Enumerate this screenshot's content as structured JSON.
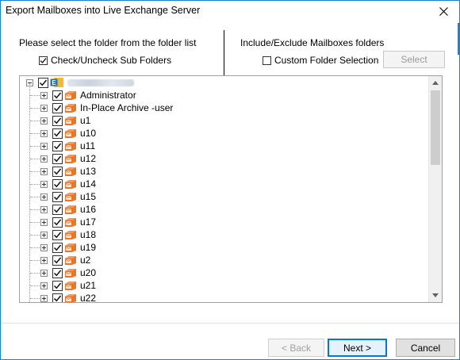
{
  "window": {
    "title": "Export Mailboxes into Live Exchange Server"
  },
  "left_panel": {
    "header": "Please select the folder from the folder list",
    "subfolders_checkbox": {
      "label": "Check/Uncheck Sub Folders",
      "checked": true
    }
  },
  "right_panel": {
    "header": "Include/Exclude Mailboxes folders",
    "custom_checkbox": {
      "label": "Custom Folder Selection",
      "checked": false
    },
    "select_button": "Select"
  },
  "tree": {
    "root": {
      "label_hidden": true,
      "expanded": true,
      "checked": true
    },
    "items": [
      {
        "label": "Administrator",
        "checked": true
      },
      {
        "label": "In-Place Archive -user",
        "checked": true
      },
      {
        "label": "u1",
        "checked": true
      },
      {
        "label": "u10",
        "checked": true
      },
      {
        "label": "u11",
        "checked": true
      },
      {
        "label": "u12",
        "checked": true
      },
      {
        "label": "u13",
        "checked": true
      },
      {
        "label": "u14",
        "checked": true
      },
      {
        "label": "u15",
        "checked": true
      },
      {
        "label": "u16",
        "checked": true
      },
      {
        "label": "u17",
        "checked": true
      },
      {
        "label": "u18",
        "checked": true
      },
      {
        "label": "u19",
        "checked": true
      },
      {
        "label": "u2",
        "checked": true
      },
      {
        "label": "u20",
        "checked": true
      },
      {
        "label": "u21",
        "checked": true
      },
      {
        "label": "u22",
        "checked": true
      }
    ]
  },
  "footer": {
    "back": "< Back",
    "next": "Next >",
    "cancel": "Cancel"
  },
  "colors": {
    "accent": "#0078d7",
    "window_border": "#1883d7",
    "mailbox_icon": "#e8762b"
  }
}
